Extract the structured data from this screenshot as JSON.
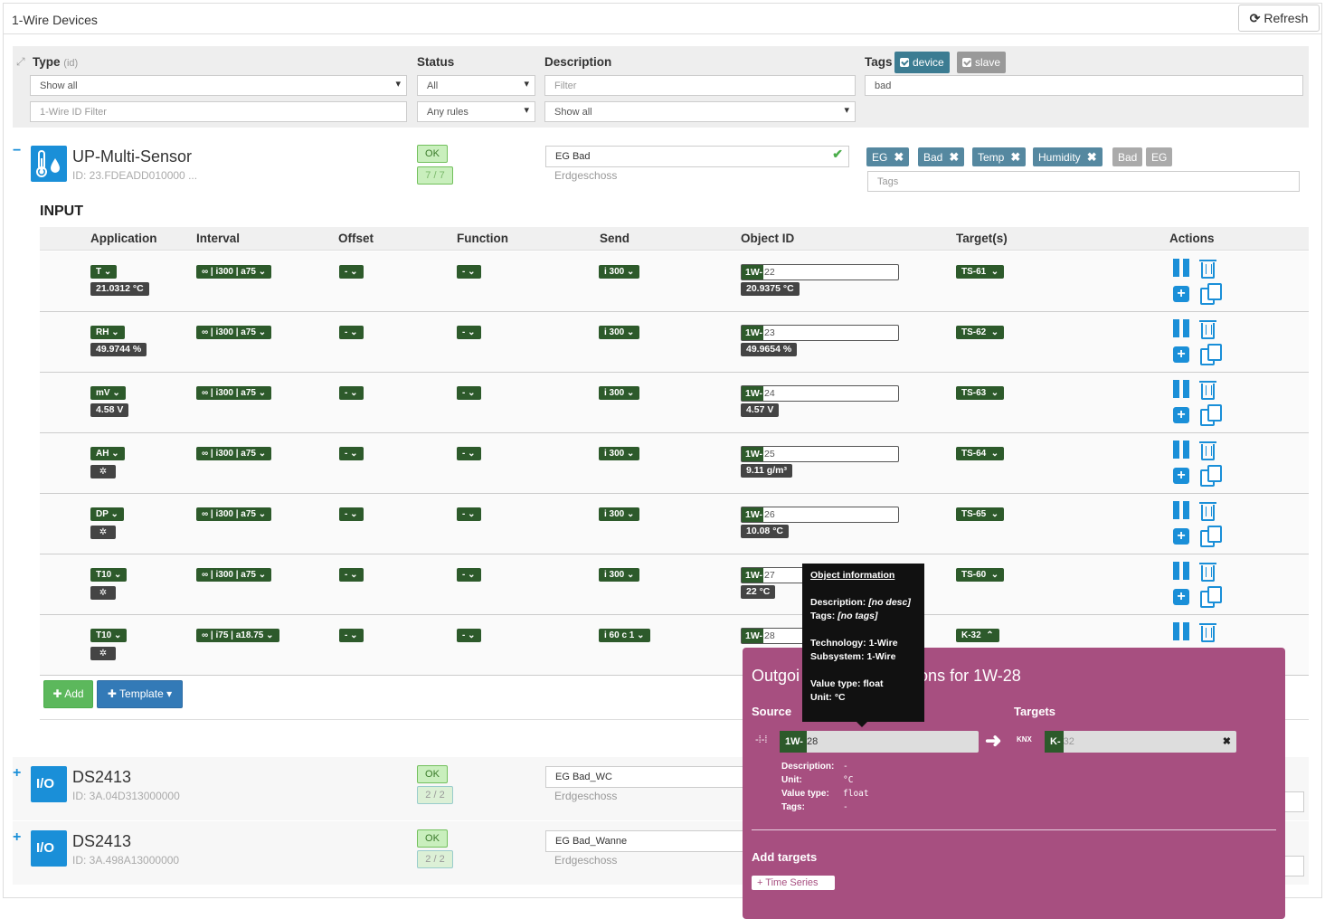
{
  "panel": {
    "title": "1-Wire Devices",
    "refresh_label": "Refresh"
  },
  "filters": {
    "type_label": "Type",
    "type_hint": "(id)",
    "type_select": "Show all",
    "id_placeholder": "1-Wire ID Filter",
    "status_label": "Status",
    "status_select": "All",
    "rules_select": "Any rules",
    "description_label": "Description",
    "description_placeholder": "Filter",
    "description_select": "Show all",
    "tags_label": "Tags",
    "tag_device": "device",
    "tag_slave": "slave",
    "tags_value": "bad"
  },
  "device1": {
    "name": "UP-Multi-Sensor",
    "id": "ID: 23.FDEADD010000 ...",
    "toggle": "−",
    "status": "OK",
    "ratio": "7 / 7",
    "description": "EG Bad",
    "location": "Erdgeschoss",
    "tags": [
      "EG",
      "Bad",
      "Temp",
      "Humidity"
    ],
    "tags_grey": [
      "Bad",
      "EG"
    ],
    "tags_placeholder": "Tags",
    "section": "INPUT"
  },
  "table": {
    "headers": [
      "Application",
      "Interval",
      "Offset",
      "Function",
      "Send",
      "Object ID",
      "Target(s)",
      "Actions"
    ],
    "rows": [
      {
        "app": "T",
        "value": "21.0312 °C",
        "interval": "∞ | i300 | a75",
        "offset": "-",
        "function": "-",
        "send": "i 300",
        "obj_prefix": "1W-",
        "obj_num": "22",
        "obj_value": "20.9375 °C",
        "target": "TS-61"
      },
      {
        "app": "RH",
        "value": "49.9744 %",
        "interval": "∞ | i300 | a75",
        "offset": "-",
        "function": "-",
        "send": "i 300",
        "obj_prefix": "1W-",
        "obj_num": "23",
        "obj_value": "49.9654 %",
        "target": "TS-62"
      },
      {
        "app": "mV",
        "value": "4.58 V",
        "interval": "∞ | i300 | a75",
        "offset": "-",
        "function": "-",
        "send": "i 300",
        "obj_prefix": "1W-",
        "obj_num": "24",
        "obj_value": "4.57 V",
        "target": "TS-63"
      },
      {
        "app": "AH",
        "value": "",
        "interval": "∞ | i300 | a75",
        "offset": "-",
        "function": "-",
        "send": "i 300",
        "obj_prefix": "1W-",
        "obj_num": "25",
        "obj_value": "9.11 g/m³",
        "target": "TS-64"
      },
      {
        "app": "DP",
        "value": "",
        "interval": "∞ | i300 | a75",
        "offset": "-",
        "function": "-",
        "send": "i 300",
        "obj_prefix": "1W-",
        "obj_num": "26",
        "obj_value": "10.08 °C",
        "target": "TS-65"
      },
      {
        "app": "T10",
        "value": "",
        "interval": "∞ | i300 | a75",
        "offset": "-",
        "function": "-",
        "send": "i 300",
        "obj_prefix": "1W-",
        "obj_num": "27",
        "obj_value": "22 °C",
        "target": "TS-60"
      },
      {
        "app": "T10",
        "value": "",
        "interval": "∞ | i75 | a18.75",
        "offset": "-",
        "function": "-",
        "send": "i 60 c 1",
        "obj_prefix": "1W-",
        "obj_num": "28",
        "obj_value": "",
        "target": "K-32"
      }
    ],
    "add_label": "Add",
    "template_label": "Template"
  },
  "device2": {
    "name": "DS2413",
    "id": "ID: 3A.04D313000000",
    "icon_text": "I/O",
    "status": "OK",
    "ratio": "2 / 2",
    "description": "EG Bad_WC",
    "location": "Erdgeschoss"
  },
  "device3": {
    "name": "DS2413",
    "id": "ID: 3A.498A13000000",
    "icon_text": "I/O",
    "status": "OK",
    "ratio": "2 / 2",
    "description": "EG Bad_Wanne",
    "location": "Erdgeschoss"
  },
  "tooltip": {
    "title": "Object information",
    "lines": [
      {
        "k": "Description:",
        "v": "[no desc]"
      },
      {
        "k": "Tags:",
        "v": "[no tags]"
      },
      {
        "k": "Technology:",
        "v": "1-Wire"
      },
      {
        "k": "Subsystem:",
        "v": "1-Wire"
      },
      {
        "k": "Value type:",
        "v": "float"
      },
      {
        "k": "Unit:",
        "v": "°C"
      }
    ]
  },
  "popup": {
    "title_left": "Outgoi",
    "title_right": "ions for 1W-28",
    "source_label": "Source",
    "targets_label": "Targets",
    "src_prefix": "1W-",
    "src_num": "28",
    "tgt_icon": "KNX",
    "tgt_prefix": "K-",
    "tgt_num": "32",
    "info": [
      {
        "k": "Description:",
        "v": "-"
      },
      {
        "k": "Unit:",
        "v": "°C"
      },
      {
        "k": "Value type:",
        "v": "float"
      },
      {
        "k": "Tags:",
        "v": "-"
      }
    ],
    "add_targets_label": "Add targets",
    "time_series_label": "+ Time Series"
  },
  "colors": {
    "accent": "#1a8fd8",
    "green": "#2d5a2b",
    "popup": "#a74f80",
    "tag": "#5588a0"
  }
}
